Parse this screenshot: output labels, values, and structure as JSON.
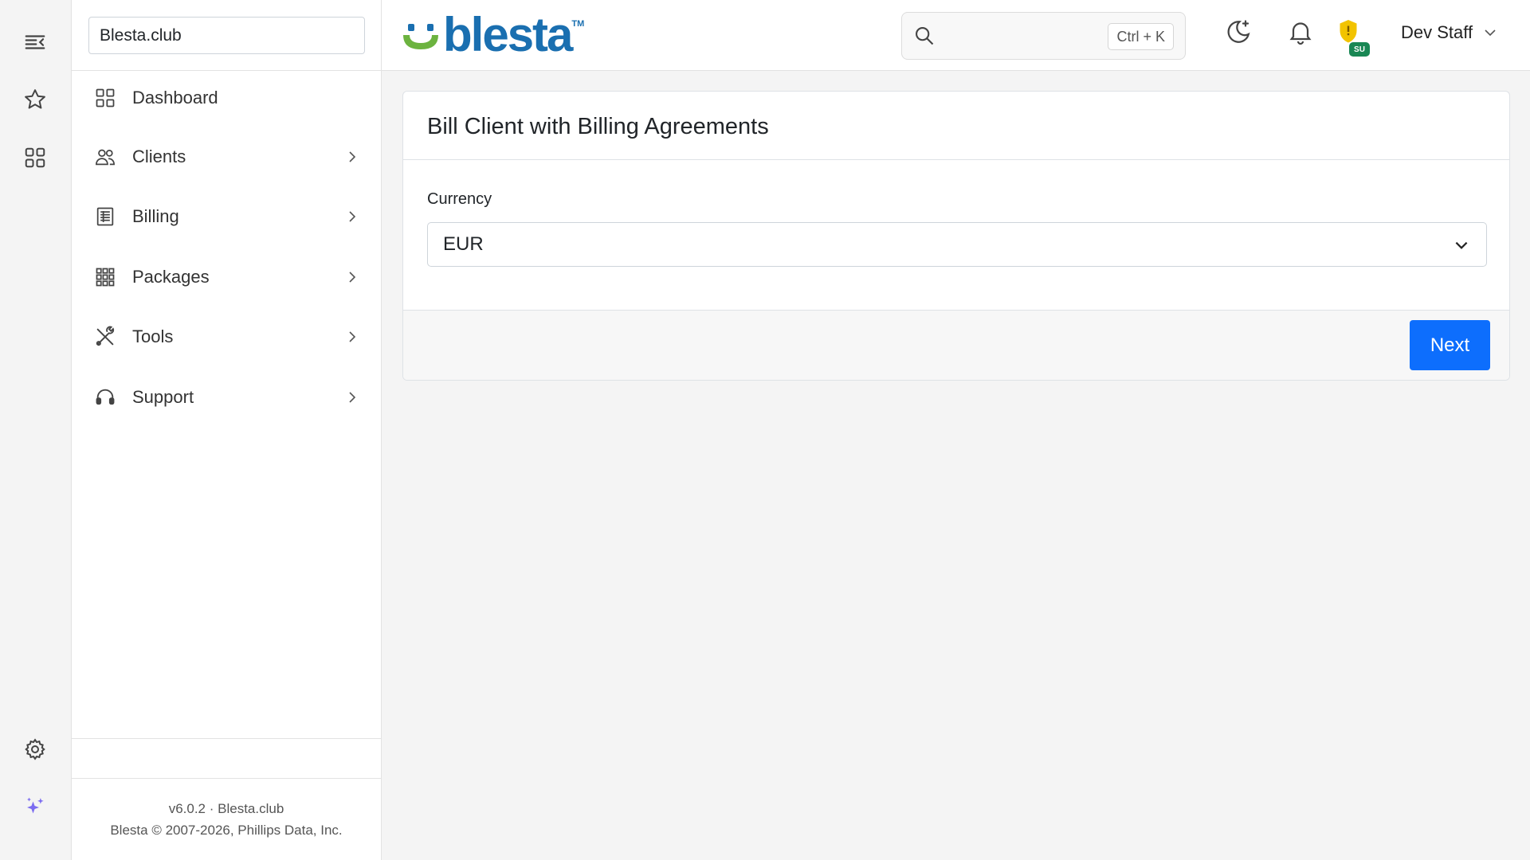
{
  "rail": {
    "icons": [
      "collapse-menu-icon",
      "star-icon",
      "apps-grid-icon",
      "gear-icon",
      "sparkles-icon"
    ]
  },
  "sidebar": {
    "company": "Blesta.club",
    "items": [
      {
        "label": "Dashboard",
        "icon": "dashboard-icon",
        "has_submenu": false
      },
      {
        "label": "Clients",
        "icon": "users-icon",
        "has_submenu": true
      },
      {
        "label": "Billing",
        "icon": "billing-icon",
        "has_submenu": true
      },
      {
        "label": "Packages",
        "icon": "packages-icon",
        "has_submenu": true
      },
      {
        "label": "Tools",
        "icon": "tools-icon",
        "has_submenu": true
      },
      {
        "label": "Support",
        "icon": "headset-icon",
        "has_submenu": true
      }
    ],
    "footer": {
      "version": "v6.0.2 · Blesta.club",
      "copyright": "Blesta © 2007-2026, Phillips Data, Inc."
    }
  },
  "header": {
    "logo_text": "blesta",
    "logo_tm": "TM",
    "search": {
      "placeholder": "",
      "shortcut": "Ctrl + K"
    },
    "su_badge": "SU",
    "user_name": "Dev Staff"
  },
  "main": {
    "card_title": "Bill Client with Billing Agreements",
    "currency_label": "Currency",
    "currency_value": "EUR",
    "next_button": "Next"
  },
  "colors": {
    "accent": "#0d6efd",
    "logo_blue": "#1a6fb0",
    "logo_green": "#6cb33f",
    "shield_yellow": "#f2c300",
    "badge_green": "#198754"
  }
}
